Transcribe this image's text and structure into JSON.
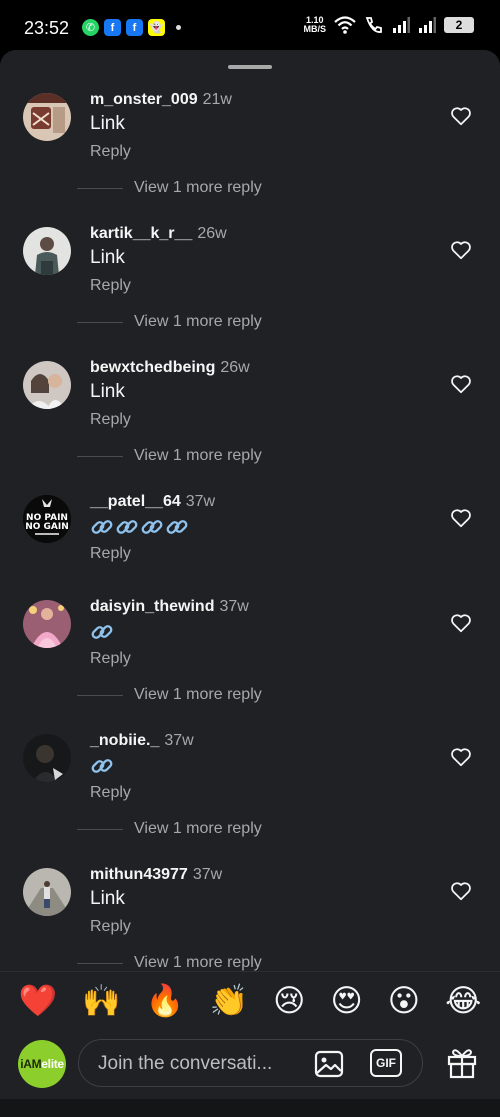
{
  "status_bar": {
    "time": "23:52",
    "app_icons": [
      "whatsapp-icon",
      "facebook-icon",
      "facebook-icon",
      "snapchat-icon"
    ],
    "net_speed_value": "1.10",
    "net_speed_unit": "MB/S",
    "battery": "2"
  },
  "comments": [
    {
      "username": "m_onster_009",
      "age": "21w",
      "text": "Link",
      "reply_label": "Reply",
      "view_more": "View 1 more reply"
    },
    {
      "username": "kartik__k_r__",
      "age": "26w",
      "text": "Link",
      "reply_label": "Reply",
      "view_more": "View 1 more reply"
    },
    {
      "username": "bewxtchedbeing",
      "age": "26w",
      "text": "Link",
      "reply_label": "Reply",
      "view_more": "View 1 more reply"
    },
    {
      "username": "__patel__64",
      "age": "37w",
      "text": "🔗🔗🔗🔗",
      "reply_label": "Reply",
      "view_more": ""
    },
    {
      "username": "daisyin_thewind",
      "age": "37w",
      "text": "🔗",
      "reply_label": "Reply",
      "view_more": "View 1 more reply"
    },
    {
      "username": "_nobiie._",
      "age": "37w",
      "text": "🔗",
      "reply_label": "Reply",
      "view_more": "View 1 more reply"
    },
    {
      "username": "mithun43977",
      "age": "37w",
      "text": "Link",
      "reply_label": "Reply",
      "view_more": "View 1 more reply"
    }
  ],
  "avatar_texts": {
    "patel_logo_line1": "NO PAIN",
    "patel_logo_line2": "NO GAIN"
  },
  "emoji_reactions": [
    "❤️",
    "🙌",
    "🔥",
    "👏",
    "😢",
    "😍",
    "😮",
    "😂"
  ],
  "composer": {
    "placeholder": "Join the conversati...",
    "gif_label": "GIF",
    "me_logo_a": "iAM",
    "me_logo_b": "elite"
  },
  "colors": {
    "sheet_bg": "#1f2125",
    "text_primary": "#f5f5f5",
    "text_secondary": "#a8a8a8",
    "link_icon": "#8fc3ee",
    "heart_red": "#e0245e"
  }
}
